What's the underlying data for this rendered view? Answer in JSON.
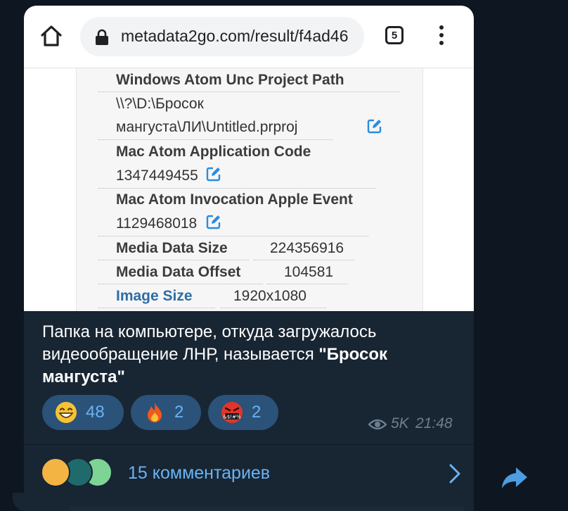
{
  "browser": {
    "url": "metadata2go.com/result/f4ad46",
    "tab_count": "5",
    "icons": [
      "home-icon",
      "lock-icon",
      "tabs-icon",
      "kebab-icon"
    ]
  },
  "metadata": [
    {
      "key": "Windows Atom Unc Project Path",
      "value_line1": "\\\\?\\D:\\Бросок",
      "value_line2": "мангуста\\ЛИ\\Untitled.prproj"
    },
    {
      "key": "Mac Atom Application Code",
      "value": "1347449455"
    },
    {
      "key": "Mac Atom Invocation Apple Event",
      "value": "1129468018"
    },
    {
      "key": "Media Data Size",
      "value": "224356916"
    },
    {
      "key": "Media Data Offset",
      "value": "104581"
    },
    {
      "key": "Image Size",
      "value": "1920x1080"
    }
  ],
  "caption": {
    "plain": "Папка на компьютере, откуда загружалось видеообращение ЛНР, называется ",
    "bold": "\"Бросок мангуста\""
  },
  "reactions": [
    {
      "emoji": "grinning-face",
      "count": "48"
    },
    {
      "emoji": "fire",
      "count": "2"
    },
    {
      "emoji": "face-with-symbols-on-mouth",
      "count": "2"
    }
  ],
  "message_meta": {
    "views": "5K",
    "time": "21:48"
  },
  "comments": {
    "label": "15 комментариев"
  },
  "colors": {
    "background": "#0e1621",
    "bubble": "#182533",
    "accent": "#6ab3f3",
    "reaction_bg": "#2b5278",
    "link": "#2e6da4"
  }
}
